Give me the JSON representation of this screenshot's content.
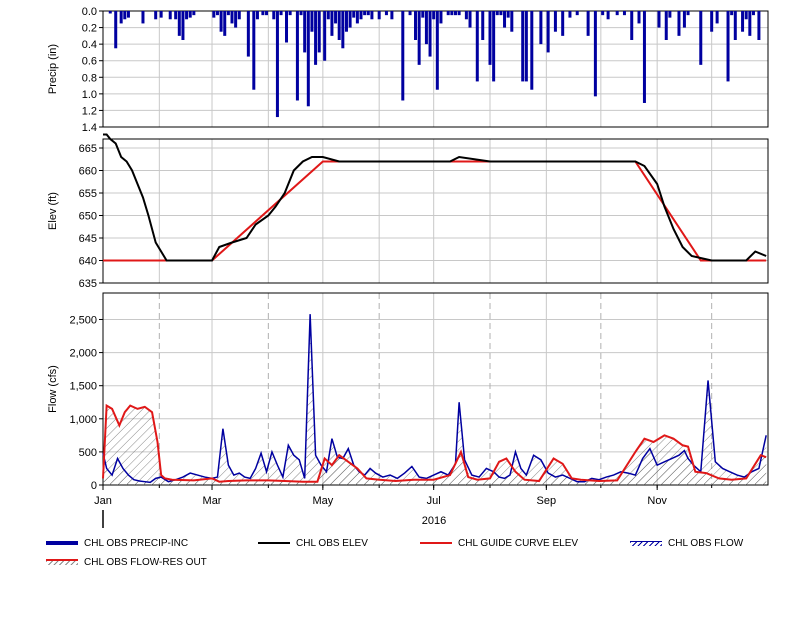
{
  "chart_data": [
    {
      "type": "bar",
      "panel": "precip",
      "ylabel": "Precip (in)",
      "ylim": [
        0,
        1.4
      ],
      "y_inverted": true,
      "yticks": [
        "0.0",
        "0.2",
        "0.4",
        "0.6",
        "0.8",
        "1.0",
        "1.2",
        "1.4"
      ],
      "grid": true,
      "series": [
        {
          "name": "CHL OBS PRECIP-INC",
          "color": "#0000a0",
          "x": [
            "2016-01-05",
            "2016-01-08",
            "2016-01-11",
            "2016-01-13",
            "2016-01-15",
            "2016-01-23",
            "2016-01-30",
            "2016-02-02",
            "2016-02-07",
            "2016-02-10",
            "2016-02-12",
            "2016-02-14",
            "2016-02-16",
            "2016-02-18",
            "2016-02-20",
            "2016-03-02",
            "2016-03-04",
            "2016-03-06",
            "2016-03-08",
            "2016-03-10",
            "2016-03-12",
            "2016-03-14",
            "2016-03-16",
            "2016-03-21",
            "2016-03-24",
            "2016-03-26",
            "2016-03-29",
            "2016-03-31",
            "2016-04-04",
            "2016-04-06",
            "2016-04-08",
            "2016-04-11",
            "2016-04-13",
            "2016-04-17",
            "2016-04-19",
            "2016-04-21",
            "2016-04-23",
            "2016-04-25",
            "2016-04-27",
            "2016-04-29",
            "2016-05-02",
            "2016-05-04",
            "2016-05-06",
            "2016-05-08",
            "2016-05-10",
            "2016-05-12",
            "2016-05-14",
            "2016-05-16",
            "2016-05-18",
            "2016-05-20",
            "2016-05-22",
            "2016-05-24",
            "2016-05-26",
            "2016-05-28",
            "2016-06-01",
            "2016-06-05",
            "2016-06-08",
            "2016-06-14",
            "2016-06-18",
            "2016-06-21",
            "2016-06-23",
            "2016-06-25",
            "2016-06-27",
            "2016-06-29",
            "2016-07-01",
            "2016-07-03",
            "2016-07-05",
            "2016-07-09",
            "2016-07-11",
            "2016-07-13",
            "2016-07-15",
            "2016-07-19",
            "2016-07-21",
            "2016-07-25",
            "2016-07-28",
            "2016-08-01",
            "2016-08-03",
            "2016-08-05",
            "2016-08-07",
            "2016-08-09",
            "2016-08-11",
            "2016-08-13",
            "2016-08-19",
            "2016-08-21",
            "2016-08-24",
            "2016-08-29",
            "2016-09-02",
            "2016-09-06",
            "2016-09-10",
            "2016-09-14",
            "2016-09-18",
            "2016-09-24",
            "2016-09-28",
            "2016-10-02",
            "2016-10-05",
            "2016-10-10",
            "2016-10-14",
            "2016-10-18",
            "2016-10-22",
            "2016-10-25",
            "2016-11-02",
            "2016-11-06",
            "2016-11-08",
            "2016-11-13",
            "2016-11-16",
            "2016-11-18",
            "2016-11-25",
            "2016-12-01",
            "2016-12-04",
            "2016-12-10",
            "2016-12-12",
            "2016-12-14",
            "2016-12-18",
            "2016-12-20",
            "2016-12-22",
            "2016-12-24",
            "2016-12-27"
          ],
          "values": [
            0.03,
            0.45,
            0.15,
            0.1,
            0.08,
            0.15,
            0.1,
            0.08,
            0.1,
            0.1,
            0.3,
            0.35,
            0.1,
            0.08,
            0.05,
            0.08,
            0.05,
            0.25,
            0.3,
            0.05,
            0.15,
            0.2,
            0.1,
            0.55,
            0.95,
            0.1,
            0.05,
            0.05,
            0.1,
            1.28,
            0.05,
            0.38,
            0.05,
            1.08,
            0.05,
            0.5,
            1.15,
            0.25,
            0.65,
            0.5,
            0.6,
            0.1,
            0.3,
            0.15,
            0.35,
            0.45,
            0.25,
            0.2,
            0.08,
            0.15,
            0.1,
            0.05,
            0.05,
            0.1,
            0.1,
            0.05,
            0.1,
            1.08,
            0.05,
            0.35,
            0.65,
            0.08,
            0.4,
            0.55,
            0.1,
            0.95,
            0.15,
            0.05,
            0.05,
            0.05,
            0.05,
            0.1,
            0.2,
            0.85,
            0.35,
            0.65,
            0.85,
            0.05,
            0.05,
            0.2,
            0.08,
            0.25,
            0.85,
            0.85,
            0.95,
            0.4,
            0.5,
            0.25,
            0.3,
            0.08,
            0.05,
            0.3,
            1.03,
            0.05,
            0.1,
            0.05,
            0.05,
            0.35,
            0.15,
            1.11,
            0.2,
            0.35,
            0.08,
            0.3,
            0.2,
            0.05,
            0.65,
            0.25,
            0.15,
            0.85,
            0.05,
            0.35,
            0.25,
            0.1,
            0.3,
            0.05,
            0.35
          ]
        }
      ]
    },
    {
      "type": "line",
      "panel": "elevation",
      "ylabel": "Elev (ft)",
      "ylim": [
        635,
        667
      ],
      "yticks": [
        "635",
        "640",
        "645",
        "650",
        "655",
        "660",
        "665"
      ],
      "grid": true,
      "series": [
        {
          "name": "CHL OBS ELEV",
          "color": "#000000",
          "x": [
            "2016-01-01",
            "2016-01-03",
            "2016-01-05",
            "2016-01-08",
            "2016-01-11",
            "2016-01-14",
            "2016-01-17",
            "2016-01-20",
            "2016-01-23",
            "2016-01-26",
            "2016-01-30",
            "2016-02-05",
            "2016-02-15",
            "2016-02-25",
            "2016-03-01",
            "2016-03-05",
            "2016-03-12",
            "2016-03-20",
            "2016-03-25",
            "2016-04-01",
            "2016-04-05",
            "2016-04-10",
            "2016-04-15",
            "2016-04-20",
            "2016-04-25",
            "2016-05-01",
            "2016-05-10",
            "2016-06-01",
            "2016-07-01",
            "2016-07-10",
            "2016-07-15",
            "2016-08-01",
            "2016-09-01",
            "2016-10-01",
            "2016-10-20",
            "2016-10-25",
            "2016-11-01",
            "2016-11-05",
            "2016-11-10",
            "2016-11-15",
            "2016-11-20",
            "2016-12-01",
            "2016-12-10",
            "2016-12-20",
            "2016-12-25",
            "2016-12-31"
          ],
          "values": [
            668,
            668,
            667,
            666,
            663,
            662,
            660,
            657,
            654,
            650,
            644,
            640,
            640,
            640,
            640,
            643,
            644,
            645,
            648,
            650,
            652,
            655,
            660,
            662,
            663,
            663,
            662,
            662,
            662,
            662,
            663,
            662,
            662,
            662,
            662,
            661,
            657,
            652,
            647,
            643,
            641,
            640,
            640,
            640,
            642,
            641
          ]
        },
        {
          "name": "CHL GUIDE CURVE ELEV",
          "color": "#e01818",
          "x": [
            "2016-01-01",
            "2016-03-01",
            "2016-05-01",
            "2016-10-20",
            "2016-11-25",
            "2016-12-31"
          ],
          "values": [
            640,
            640,
            662,
            662,
            640,
            640
          ]
        }
      ]
    },
    {
      "type": "area",
      "panel": "flow",
      "ylabel": "Flow (cfs)",
      "ylim": [
        0,
        2900
      ],
      "yticks": [
        "0",
        "500",
        "1,000",
        "1,500",
        "2,000",
        "2,500"
      ],
      "xlabel": "2016",
      "xticks": [
        "Jan",
        "Mar",
        "May",
        "Jul",
        "Sep",
        "Nov"
      ],
      "grid": true,
      "series": [
        {
          "name": "CHL OBS FLOW",
          "color": "#0000a0",
          "x": [
            "2016-01-01",
            "2016-01-03",
            "2016-01-06",
            "2016-01-09",
            "2016-01-12",
            "2016-01-15",
            "2016-01-18",
            "2016-01-21",
            "2016-01-24",
            "2016-01-27",
            "2016-01-30",
            "2016-02-02",
            "2016-02-06",
            "2016-02-10",
            "2016-02-14",
            "2016-02-18",
            "2016-02-22",
            "2016-02-26",
            "2016-03-01",
            "2016-03-04",
            "2016-03-07",
            "2016-03-10",
            "2016-03-13",
            "2016-03-16",
            "2016-03-19",
            "2016-03-22",
            "2016-03-25",
            "2016-03-28",
            "2016-03-31",
            "2016-04-03",
            "2016-04-06",
            "2016-04-09",
            "2016-04-12",
            "2016-04-15",
            "2016-04-18",
            "2016-04-21",
            "2016-04-24",
            "2016-04-27",
            "2016-04-30",
            "2016-05-03",
            "2016-05-06",
            "2016-05-09",
            "2016-05-12",
            "2016-05-15",
            "2016-05-18",
            "2016-05-21",
            "2016-05-24",
            "2016-05-27",
            "2016-05-30",
            "2016-06-03",
            "2016-06-07",
            "2016-06-11",
            "2016-06-15",
            "2016-06-19",
            "2016-06-23",
            "2016-06-27",
            "2016-07-01",
            "2016-07-05",
            "2016-07-09",
            "2016-07-13",
            "2016-07-15",
            "2016-07-18",
            "2016-07-22",
            "2016-07-26",
            "2016-07-30",
            "2016-08-03",
            "2016-08-06",
            "2016-08-09",
            "2016-08-12",
            "2016-08-15",
            "2016-08-18",
            "2016-08-21",
            "2016-08-25",
            "2016-08-29",
            "2016-09-02",
            "2016-09-06",
            "2016-09-10",
            "2016-09-14",
            "2016-09-18",
            "2016-09-22",
            "2016-09-26",
            "2016-09-30",
            "2016-10-04",
            "2016-10-08",
            "2016-10-12",
            "2016-10-16",
            "2016-10-20",
            "2016-10-24",
            "2016-10-28",
            "2016-11-01",
            "2016-11-05",
            "2016-11-09",
            "2016-11-13",
            "2016-11-16",
            "2016-11-18",
            "2016-11-21",
            "2016-11-25",
            "2016-11-29",
            "2016-12-03",
            "2016-12-07",
            "2016-12-11",
            "2016-12-15",
            "2016-12-19",
            "2016-12-23",
            "2016-12-27",
            "2016-12-31"
          ],
          "values": [
            480,
            250,
            150,
            400,
            250,
            150,
            80,
            60,
            50,
            40,
            100,
            120,
            50,
            80,
            120,
            180,
            150,
            120,
            100,
            120,
            850,
            300,
            150,
            180,
            120,
            100,
            250,
            480,
            200,
            500,
            300,
            120,
            600,
            450,
            380,
            100,
            2580,
            450,
            300,
            200,
            700,
            420,
            400,
            550,
            300,
            200,
            150,
            250,
            180,
            120,
            150,
            100,
            180,
            280,
            120,
            100,
            150,
            200,
            150,
            320,
            1250,
            380,
            150,
            120,
            250,
            200,
            120,
            100,
            150,
            500,
            250,
            150,
            450,
            380,
            180,
            120,
            150,
            100,
            50,
            50,
            100,
            80,
            120,
            150,
            200,
            180,
            150,
            400,
            550,
            300,
            350,
            400,
            450,
            520,
            400,
            300,
            200,
            1580,
            350,
            250,
            200,
            150,
            120,
            200,
            250,
            750
          ]
        },
        {
          "name": "CHL OBS FLOW-RES OUT",
          "color": "#e01818",
          "x": [
            "2016-01-01",
            "2016-01-03",
            "2016-01-06",
            "2016-01-10",
            "2016-01-13",
            "2016-01-16",
            "2016-01-20",
            "2016-01-24",
            "2016-01-28",
            "2016-01-31",
            "2016-02-02",
            "2016-02-04",
            "2016-02-08",
            "2016-02-20",
            "2016-03-01",
            "2016-03-05",
            "2016-03-10",
            "2016-03-20",
            "2016-04-01",
            "2016-04-10",
            "2016-04-20",
            "2016-04-28",
            "2016-05-02",
            "2016-05-06",
            "2016-05-10",
            "2016-05-15",
            "2016-05-20",
            "2016-05-25",
            "2016-06-01",
            "2016-06-10",
            "2016-06-20",
            "2016-07-01",
            "2016-07-10",
            "2016-07-16",
            "2016-07-20",
            "2016-07-25",
            "2016-08-01",
            "2016-08-06",
            "2016-08-10",
            "2016-08-15",
            "2016-08-20",
            "2016-08-28",
            "2016-09-05",
            "2016-09-10",
            "2016-09-15",
            "2016-09-20",
            "2016-09-30",
            "2016-10-10",
            "2016-10-20",
            "2016-10-25",
            "2016-10-30",
            "2016-11-05",
            "2016-11-10",
            "2016-11-15",
            "2016-11-18",
            "2016-11-22",
            "2016-11-28",
            "2016-12-05",
            "2016-12-12",
            "2016-12-20",
            "2016-12-28",
            "2016-12-31"
          ],
          "values": [
            100,
            1200,
            1150,
            900,
            1100,
            1200,
            1150,
            1180,
            1100,
            650,
            150,
            100,
            80,
            70,
            100,
            50,
            60,
            70,
            70,
            60,
            50,
            50,
            400,
            300,
            450,
            350,
            250,
            100,
            80,
            60,
            80,
            80,
            150,
            500,
            120,
            80,
            100,
            350,
            400,
            200,
            80,
            60,
            400,
            320,
            100,
            80,
            60,
            70,
            500,
            700,
            650,
            750,
            700,
            600,
            580,
            200,
            180,
            100,
            80,
            100,
            450,
            420
          ]
        }
      ]
    }
  ],
  "legend": {
    "precip": "CHL OBS PRECIP-INC",
    "obs_elev": "CHL OBS ELEV",
    "guide": "CHL GUIDE CURVE ELEV",
    "obs_flow": "CHL OBS FLOW",
    "res_out": "CHL OBS FLOW-RES OUT"
  }
}
